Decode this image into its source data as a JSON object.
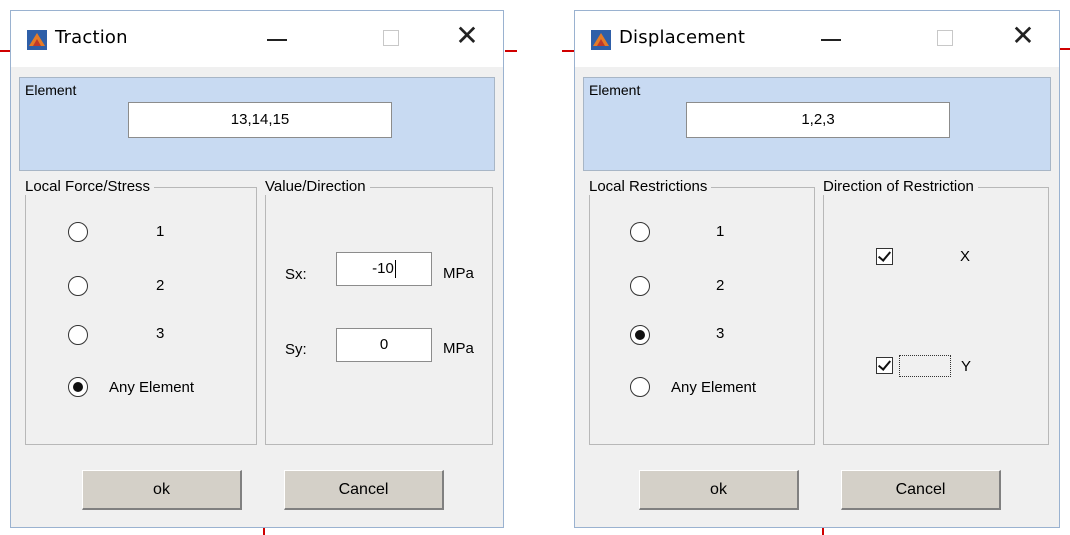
{
  "left_dialog": {
    "title": "Traction",
    "element_label": "Element",
    "element_value": "13,14,15",
    "local_group_title": "Local Force/Stress",
    "radios": [
      {
        "label": "1",
        "checked": false
      },
      {
        "label": "2",
        "checked": false
      },
      {
        "label": "3",
        "checked": false
      },
      {
        "label": "Any Element",
        "checked": true
      }
    ],
    "value_group_title": "Value/Direction",
    "sx_label": "Sx:",
    "sx_value": "-10",
    "sy_label": "Sy:",
    "sy_value": "0",
    "unit": "MPa",
    "ok_label": "ok",
    "cancel_label": "Cancel"
  },
  "right_dialog": {
    "title": "Displacement",
    "element_label": "Element",
    "element_value": "1,2,3",
    "local_group_title": "Local Restrictions",
    "radios": [
      {
        "label": "1",
        "checked": false
      },
      {
        "label": "2",
        "checked": false
      },
      {
        "label": "3",
        "checked": true
      },
      {
        "label": "Any Element",
        "checked": false
      }
    ],
    "direction_group_title": "Direction of Restriction",
    "check_x_label": "X",
    "check_x_checked": true,
    "check_y_label": "Y",
    "check_y_checked": true,
    "ok_label": "ok",
    "cancel_label": "Cancel"
  },
  "titlebar_controls": {
    "minimize": "—",
    "maximize": "□",
    "close": "✕"
  },
  "colors": {
    "accent_panel": "#c8daf2",
    "dialog_bg": "#f0f0f0",
    "button_face": "#d4d0c8",
    "background_line": "#d00000"
  }
}
